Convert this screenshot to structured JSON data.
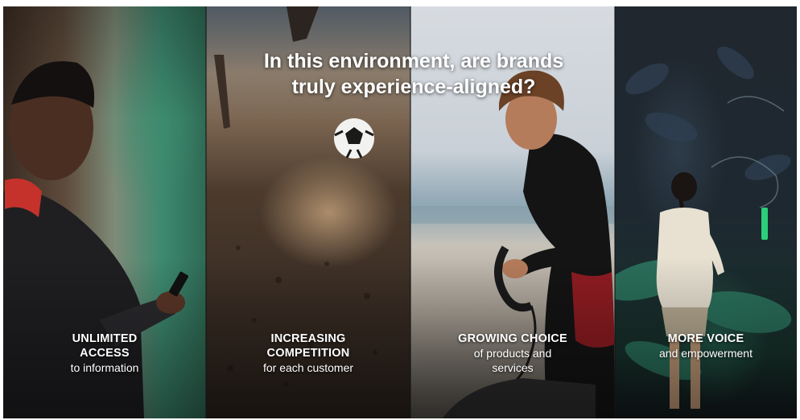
{
  "headline": {
    "line1": "In this environment, are brands",
    "line2": "truly experience-aligned?"
  },
  "panels": [
    {
      "title_line1": "UNLIMITED",
      "title_line2": "ACCESS",
      "subtitle_line1": "to information",
      "subtitle_line2": ""
    },
    {
      "title_line1": "INCREASING",
      "title_line2": "COMPETITION",
      "subtitle_line1": "for each customer",
      "subtitle_line2": ""
    },
    {
      "title_line1": "GROWING CHOICE",
      "title_line2": "",
      "subtitle_line1": "of products and",
      "subtitle_line2": "services"
    },
    {
      "title_line1": "MORE VOICE",
      "title_line2": "",
      "subtitle_line1": "and empowerment",
      "subtitle_line2": ""
    }
  ],
  "colors": {
    "text": "#ffffff",
    "panel_1_accent": "#3d8a70",
    "panel_4_accent": "#286e5a"
  },
  "icons": [
    "person-with-phone-icon",
    "soccer-ball-icon",
    "surfer-with-leash-icon",
    "person-at-mural-icon"
  ]
}
